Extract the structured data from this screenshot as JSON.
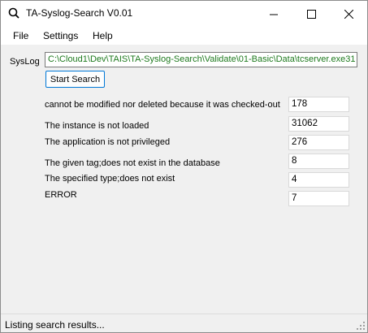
{
  "window": {
    "title": "TA-Syslog-Search V0.01"
  },
  "menu": [
    "File",
    "Settings",
    "Help"
  ],
  "syslog": {
    "label": "SysLog",
    "path": "C:\\Cloud1\\Dev\\TAIS\\TA-Syslog-Search\\Validate\\01-Basic\\Data\\tcserver.exe31"
  },
  "search_button": "Start Search",
  "results": [
    {
      "label": "cannot be modified nor deleted because it was checked-out",
      "count": "178"
    },
    {
      "label": "The instance is not loaded",
      "count": "31062"
    },
    {
      "label": "The application is not privileged",
      "count": "276"
    },
    {
      "label": "The given tag;does not exist in the database",
      "count": "8"
    },
    {
      "label": "The specified type;does not exist",
      "count": "4"
    },
    {
      "label": "ERROR",
      "count": "7"
    }
  ],
  "status": "Listing search results...",
  "icons": {
    "app": "search-icon",
    "minimize": "minimize-icon",
    "maximize": "maximize-icon",
    "close": "close-icon",
    "grip": "resize-grip-icon"
  }
}
